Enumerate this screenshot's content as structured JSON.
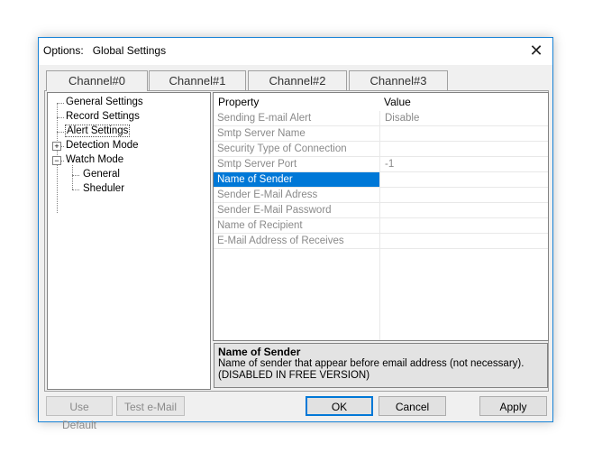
{
  "window": {
    "title": "Options:   Global Settings",
    "close_glyph": "✕"
  },
  "tabs": [
    {
      "label": "Channel#0",
      "selected": true
    },
    {
      "label": "Channel#1"
    },
    {
      "label": "Channel#2"
    },
    {
      "label": "Channel#3"
    }
  ],
  "tree": {
    "items": [
      {
        "label": "General Settings"
      },
      {
        "label": "Record Settings"
      },
      {
        "label": "Alert Settings",
        "selected": true
      },
      {
        "label": "Detection Mode",
        "expander": "+"
      },
      {
        "label": "Watch Mode",
        "expander": "−"
      },
      {
        "label": "General"
      },
      {
        "label": "Sheduler"
      }
    ]
  },
  "grid": {
    "header_property": "Property",
    "header_value": "Value",
    "rows": [
      {
        "property": "Sending E-mail Alert",
        "value": "Disable"
      },
      {
        "property": "Smtp Server Name",
        "value": ""
      },
      {
        "property": "Security Type of Connection",
        "value": ""
      },
      {
        "property": "Smtp Server Port",
        "value": "-1"
      },
      {
        "property": "Name of Sender",
        "value": "",
        "selected": true
      },
      {
        "property": "Sender E-Mail Adress",
        "value": ""
      },
      {
        "property": "Sender E-Mail Password",
        "value": ""
      },
      {
        "property": "Name of Recipient",
        "value": ""
      },
      {
        "property": "E-Mail Address of Receives",
        "value": ""
      }
    ]
  },
  "description": {
    "title": "Name of Sender",
    "line1": "Name of sender that appear before email address (not necessary).",
    "line2": "(DISABLED IN FREE VERSION)"
  },
  "buttons": {
    "use_default": "Use Default",
    "test_email": "Test e-Mail",
    "ok": "OK",
    "cancel": "Cancel",
    "apply": "Apply"
  },
  "colors": {
    "accent": "#0078d7",
    "border": "#1883d7"
  }
}
